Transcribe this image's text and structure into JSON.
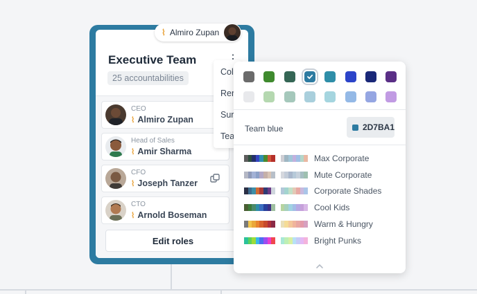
{
  "owner_chip": {
    "name": "Almiro Zupan"
  },
  "team_card": {
    "title": "Executive Team",
    "accountabilities": "25 accountabilities",
    "roles": [
      {
        "title": "CEO",
        "name": "Almiro Zupan"
      },
      {
        "title": "Head of Sales",
        "name": "Amir Sharma"
      },
      {
        "title": "CFO",
        "name": "Joseph Tanzer"
      },
      {
        "title": "CTO",
        "name": "Arnold Boseman"
      }
    ],
    "edit_button": "Edit roles",
    "accent_color": "#2D7BA1"
  },
  "context_menu": {
    "items": [
      "Col",
      "Ren",
      "Sur",
      "Tea"
    ]
  },
  "color_picker": {
    "swatches_row1": [
      "#6b6b6b",
      "#3f8a2e",
      "#356655",
      "#2d7ba1",
      "#2f8ea8",
      "#2c44c9",
      "#1a2878",
      "#5a2f86"
    ],
    "swatches_row2": [
      "#e8e9ec",
      "#b5d8b0",
      "#a5c8bb",
      "#a9cfdc",
      "#a5d5df",
      "#94b9e6",
      "#95a6e2",
      "#c19be3"
    ],
    "selected_index": 3,
    "team_color_label": "Team blue",
    "hex_value": "2D7BA1",
    "palettes": [
      {
        "name": "Max Corporate",
        "colors": [
          "#5d5d5d",
          "#2f4f3e",
          "#24306b",
          "#3445c1",
          "#2e8fb0",
          "#4b8a2e",
          "#d0573a",
          "#b5302a",
          "#cfcfd4",
          "#9fb6c2",
          "#a2c6d8",
          "#c2b0dd",
          "#a0bfe5",
          "#b3d6c9",
          "#e9b8a2"
        ]
      },
      {
        "name": "Mute Corporate",
        "colors": [
          "#b5b8c5",
          "#8f9ab8",
          "#a3b2d6",
          "#8da1c8",
          "#b2a8c7",
          "#c5b0a9",
          "#d8c4b5",
          "#b7bfc9",
          "#d5d8de",
          "#c3ccd8",
          "#a9b7cc",
          "#b6c9d8",
          "#c6d1dc",
          "#a7bec3",
          "#9ec0b0"
        ]
      },
      {
        "name": "Corporate Shades",
        "colors": [
          "#2b2f45",
          "#3d6b8e",
          "#3e8fa7",
          "#d06a35",
          "#a83b3b",
          "#2f3b74",
          "#6b3a86",
          "#cfd6dd",
          "#b2c8d9",
          "#a3d4cf",
          "#c2e0c7",
          "#e3c9b5",
          "#e7a9a4",
          "#c9b9dd",
          "#aac5e8"
        ]
      },
      {
        "name": "Cool Kids",
        "colors": [
          "#4a5f33",
          "#3c7a3a",
          "#4a8a6a",
          "#2f8ea8",
          "#3b6ec0",
          "#283f9c",
          "#3d2f86",
          "#9ebfa0",
          "#b6d4a0",
          "#a6d0bb",
          "#9fd2e2",
          "#a3bde6",
          "#b6a9e2",
          "#c6a0da",
          "#d8b8e6"
        ]
      },
      {
        "name": "Warm & Hungry",
        "colors": [
          "#7a7a7a",
          "#f2c54d",
          "#eaa83a",
          "#e9862f",
          "#d9632e",
          "#c84a2b",
          "#b0303a",
          "#8a2946",
          "#e9dfb8",
          "#f5dc96",
          "#f4c79a",
          "#f0b59c",
          "#e9a7a1",
          "#e39aaa",
          "#d6a0c0"
        ]
      },
      {
        "name": "Bright Punks",
        "colors": [
          "#2cc29a",
          "#5cd15b",
          "#9bdc3a",
          "#39b8e8",
          "#4a6ef0",
          "#9b4df0",
          "#e83fd0",
          "#f0474f",
          "#a9e8d6",
          "#bdefb5",
          "#d7efa4",
          "#b7e1f6",
          "#c6cbf7",
          "#e4b9f4",
          "#f3b3dc"
        ]
      }
    ]
  }
}
